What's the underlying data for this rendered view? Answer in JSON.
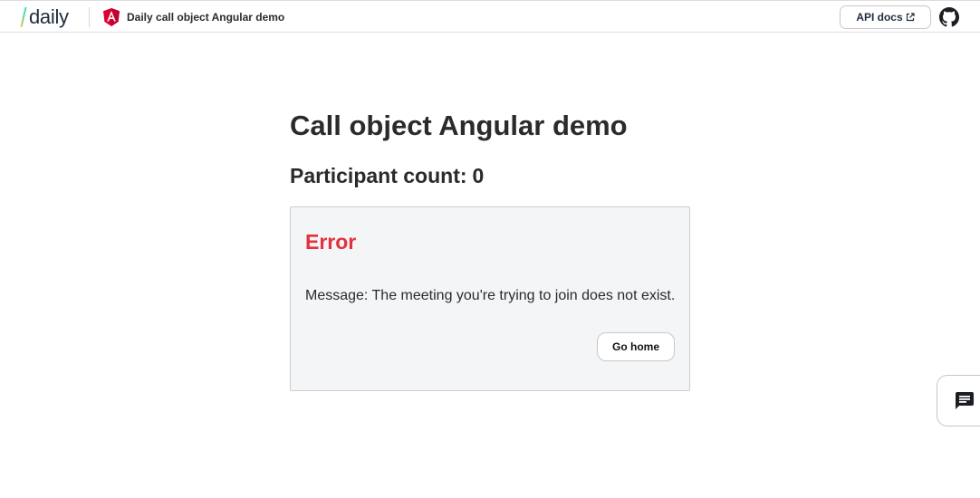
{
  "header": {
    "brand": "daily",
    "demo_title": "Daily call object Angular demo",
    "api_docs_label": "API docs"
  },
  "main": {
    "title": "Call object Angular demo",
    "participant_label": "Participant count:",
    "participant_count": "0"
  },
  "error": {
    "title": "Error",
    "message": "Message: The meeting you're trying to join does not exist.",
    "go_home_label": "Go home"
  },
  "colors": {
    "error_red": "#e3323d",
    "angular_red": "#dd0031",
    "card_bg": "#f4f5f7"
  },
  "icons": [
    "daily-logo-icon",
    "angular-icon",
    "external-link-icon",
    "github-icon",
    "chat-icon"
  ]
}
